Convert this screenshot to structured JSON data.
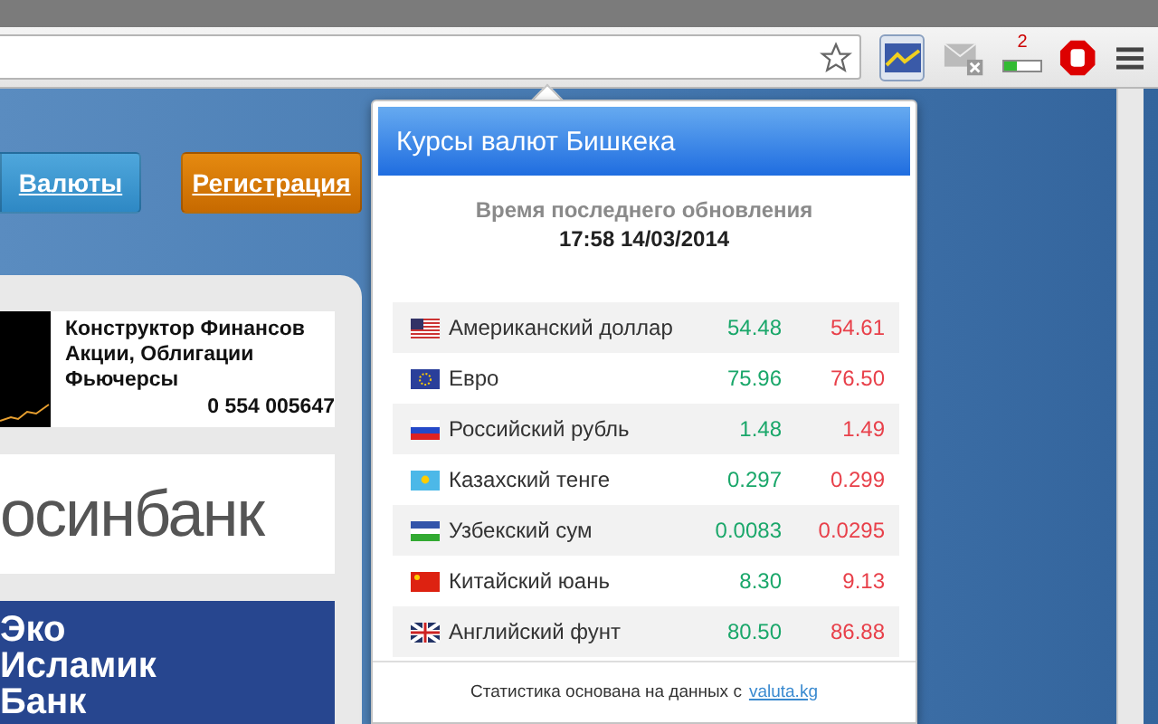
{
  "toolbar": {
    "badge": "2"
  },
  "nav_buttons": [
    {
      "label": "Валюты",
      "kind": "blue"
    },
    {
      "label": "Регистрация",
      "kind": "orange"
    }
  ],
  "ads": [
    {
      "kind": "finance",
      "lines": [
        "Конструктор Финансов",
        "Акции, Облигации",
        "Фьючерсы"
      ],
      "phone": "0 554 005647"
    },
    {
      "kind": "bank",
      "lines": [
        "осинбанк"
      ]
    },
    {
      "kind": "islamic",
      "lines": [
        "Эко",
        "Исламик",
        "Банк"
      ]
    }
  ],
  "popup": {
    "title": "Курсы валют Бишкека",
    "update_label": "Время последнего обновления",
    "update_time": "17:58 14/03/2014",
    "rates": [
      {
        "kind": "us",
        "name": "Американский доллар",
        "buy": "54.48",
        "sell": "54.61"
      },
      {
        "kind": "eu",
        "name": "Евро",
        "buy": "75.96",
        "sell": "76.50"
      },
      {
        "kind": "ru",
        "name": "Российский рубль",
        "buy": "1.48",
        "sell": "1.49"
      },
      {
        "kind": "kz",
        "name": "Казахский тенге",
        "buy": "0.297",
        "sell": "0.299"
      },
      {
        "kind": "uz",
        "name": "Узбекский сум",
        "buy": "0.0083",
        "sell": "0.0295"
      },
      {
        "kind": "cn",
        "name": "Китайский юань",
        "buy": "8.30",
        "sell": "9.13"
      },
      {
        "kind": "gb",
        "name": "Английский фунт",
        "buy": "80.50",
        "sell": "86.88"
      }
    ],
    "footer_text": "Статистика основана на данных с",
    "footer_link": "valuta.kg"
  }
}
